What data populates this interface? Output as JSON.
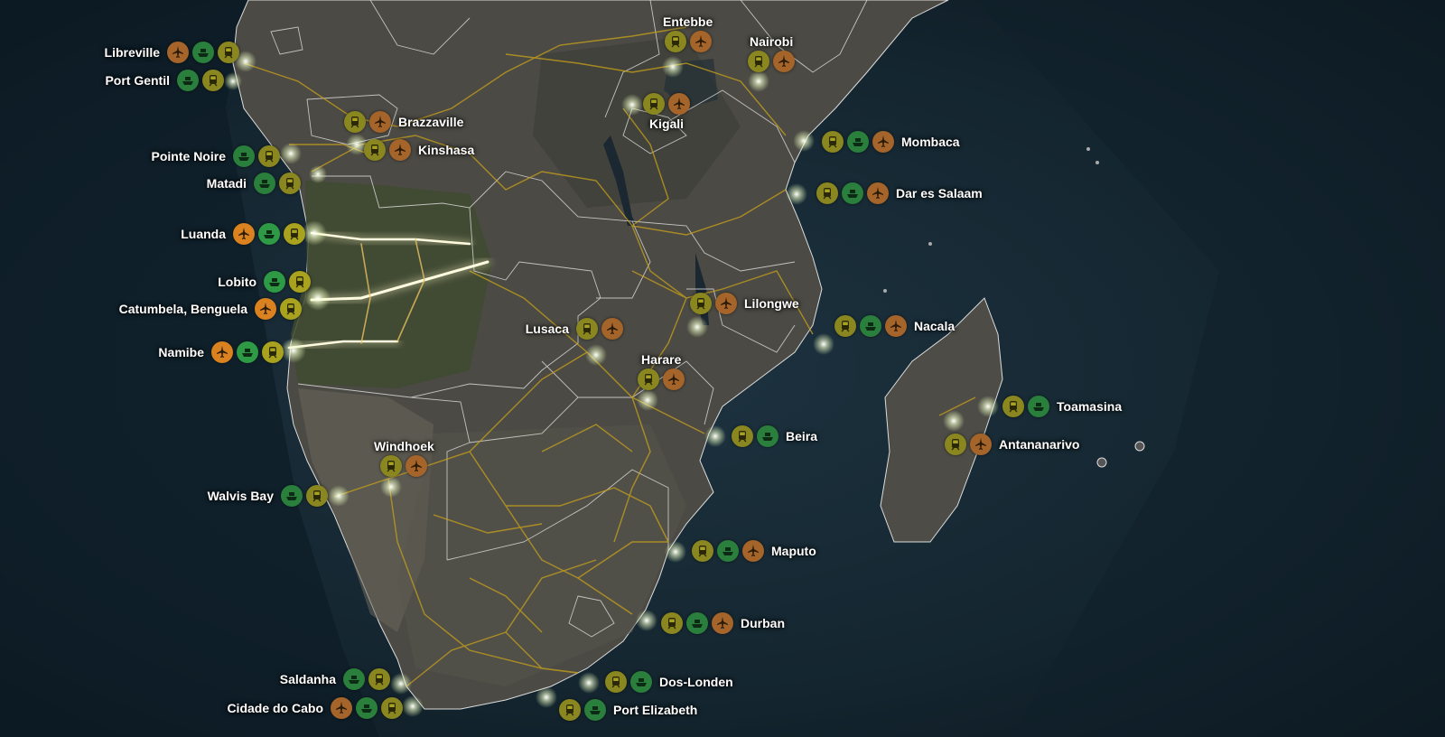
{
  "legend_icons": {
    "rail": {
      "icon": "train-icon",
      "color": "#a8a21f"
    },
    "port": {
      "icon": "ship-icon",
      "color": "#2e9a45"
    },
    "air": {
      "icon": "airplane-icon",
      "color": "#d9821f"
    }
  },
  "cities": [
    {
      "id": "libreville",
      "name": "Libreville",
      "icons": [
        "air",
        "port",
        "rail"
      ],
      "dim": true
    },
    {
      "id": "port-gentil",
      "name": "Port Gentil",
      "icons": [
        "port",
        "rail"
      ],
      "dim": true
    },
    {
      "id": "brazzaville",
      "name": "Brazzaville",
      "icons": [
        "rail",
        "air"
      ],
      "dim": true
    },
    {
      "id": "kinshasa",
      "name": "Kinshasa",
      "icons": [
        "rail",
        "air"
      ],
      "dim": true
    },
    {
      "id": "pointe-noire",
      "name": "Pointe Noire",
      "icons": [
        "port",
        "rail"
      ],
      "dim": true
    },
    {
      "id": "matadi",
      "name": "Matadi",
      "icons": [
        "port",
        "rail"
      ],
      "dim": true
    },
    {
      "id": "luanda",
      "name": "Luanda",
      "icons": [
        "air",
        "port",
        "rail"
      ],
      "dim": false
    },
    {
      "id": "lobito",
      "name": "Lobito",
      "icons": [
        "port",
        "rail"
      ],
      "dim": false
    },
    {
      "id": "catumbela",
      "name": "Catumbela, Benguela",
      "icons": [
        "air",
        "rail"
      ],
      "dim": false
    },
    {
      "id": "namibe",
      "name": "Namibe",
      "icons": [
        "air",
        "port",
        "rail"
      ],
      "dim": false
    },
    {
      "id": "windhoek",
      "name": "Windhoek",
      "icons": [
        "rail",
        "air"
      ],
      "dim": true
    },
    {
      "id": "walvis-bay",
      "name": "Walvis Bay",
      "icons": [
        "port",
        "rail"
      ],
      "dim": true
    },
    {
      "id": "saldanha",
      "name": "Saldanha",
      "icons": [
        "port",
        "rail"
      ],
      "dim": true
    },
    {
      "id": "cidade-do-cabo",
      "name": "Cidade do Cabo",
      "icons": [
        "air",
        "port",
        "rail"
      ],
      "dim": true
    },
    {
      "id": "port-elizabeth",
      "name": "Port Elizabeth",
      "icons": [
        "rail",
        "port"
      ],
      "dim": true
    },
    {
      "id": "dos-londen",
      "name": "Dos-Londen",
      "icons": [
        "rail",
        "port"
      ],
      "dim": true
    },
    {
      "id": "durban",
      "name": "Durban",
      "icons": [
        "rail",
        "port",
        "air"
      ],
      "dim": true
    },
    {
      "id": "maputo",
      "name": "Maputo",
      "icons": [
        "rail",
        "port",
        "air"
      ],
      "dim": true
    },
    {
      "id": "beira",
      "name": "Beira",
      "icons": [
        "rail",
        "port"
      ],
      "dim": true
    },
    {
      "id": "harare",
      "name": "Harare",
      "icons": [
        "rail",
        "air"
      ],
      "dim": true
    },
    {
      "id": "lusaca",
      "name": "Lusaca",
      "icons": [
        "rail",
        "air"
      ],
      "dim": true
    },
    {
      "id": "lilongwe",
      "name": "Lilongwe",
      "icons": [
        "rail",
        "air"
      ],
      "dim": true
    },
    {
      "id": "nacala",
      "name": "Nacala",
      "icons": [
        "rail",
        "port",
        "air"
      ],
      "dim": true
    },
    {
      "id": "dar-es-salaam",
      "name": "Dar es Salaam",
      "icons": [
        "rail",
        "port",
        "air"
      ],
      "dim": true
    },
    {
      "id": "mombaca",
      "name": "Mombaca",
      "icons": [
        "rail",
        "port",
        "air"
      ],
      "dim": true
    },
    {
      "id": "nairobi",
      "name": "Nairobi",
      "icons": [
        "rail",
        "air"
      ],
      "dim": true
    },
    {
      "id": "entebbe",
      "name": "Entebbe",
      "icons": [
        "rail",
        "air"
      ],
      "dim": true
    },
    {
      "id": "kigali",
      "name": "Kigali",
      "icons": [
        "rail",
        "air"
      ],
      "dim": true
    },
    {
      "id": "toamasina",
      "name": "Toamasina",
      "icons": [
        "rail",
        "port"
      ],
      "dim": true
    },
    {
      "id": "antananarivo",
      "name": "Antananarivo",
      "icons": [
        "rail",
        "air"
      ],
      "dim": true
    }
  ]
}
